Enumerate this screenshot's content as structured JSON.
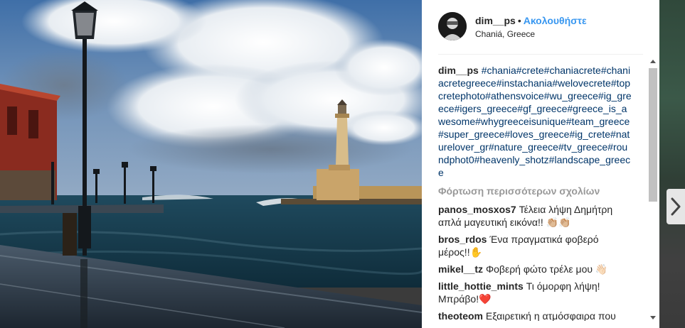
{
  "post": {
    "username": "dim__ps",
    "separator": "•",
    "follow_label": "Ακολουθήστε",
    "location": "Chaniá, Greece"
  },
  "caption": {
    "username": "dim__ps",
    "hashtags": "#chania#crete#chaniacrete#chaniacretegreece#instachania#welovecrete#topcretephoto#athensvoice#wu_greece#ig_greece#igers_greece#gf_greece#greece_is_awesome#whygreeceisunique#team_greece#super_greece#loves_greece#ig_crete#naturelover_gr#nature_greece#tv_greece#roundphot0#heavenly_shotz#landscape_greece"
  },
  "load_more_label": "Φόρτωση περισσότερων σχολίων",
  "comments": [
    {
      "user": "panos_mosxos7",
      "text": "Τέλεια λήψη Δημήτρη απλά μαγευτική εικόνα!! 👏🏼👏🏼"
    },
    {
      "user": "bros_rdos",
      "text": "Ένα πραγματικά φοβερό μέρος!!✋"
    },
    {
      "user": "mikel__tz",
      "text": "Φοβερή φώτο τρέλε μου 👋🏻"
    },
    {
      "user": "little_hottie_mints",
      "text": "Τι όμορφη λήψη! Μπράβο!❤️"
    },
    {
      "user": "theoteom",
      "text": "Εξαιρετική η ατμόσφαιρα που δίνεις πάντα μέσα από την μάτια σου για"
    }
  ],
  "icons": {
    "next": "chevron-right-icon",
    "scroll_up": "arrow-up-icon",
    "scroll_down": "arrow-down-icon"
  },
  "colors": {
    "link": "#3897f0",
    "hashtag": "#003569",
    "muted": "#999999"
  }
}
